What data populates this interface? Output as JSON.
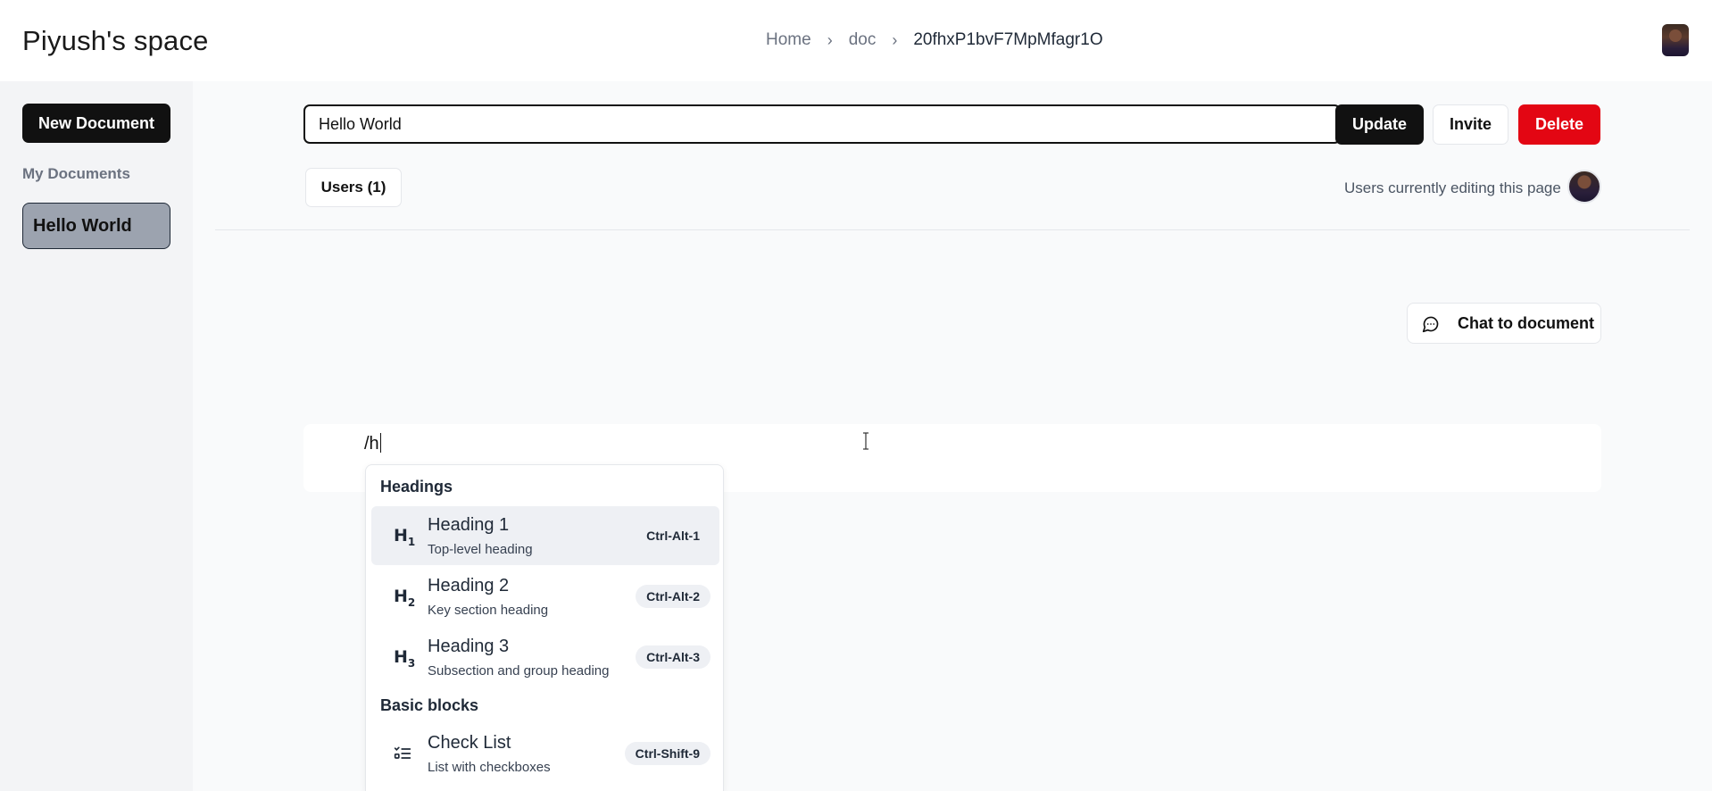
{
  "header": {
    "brand": "Piyush's space",
    "breadcrumb": [
      "Home",
      "doc",
      "20fhxP1bvF7MpMfagr1O"
    ]
  },
  "sidebar": {
    "new_document_label": "New Document",
    "section_label": "My Documents",
    "documents": [
      "Hello World"
    ]
  },
  "toolbar": {
    "title_value": "Hello World",
    "update_label": "Update",
    "invite_label": "Invite",
    "delete_label": "Delete",
    "delete_color": "#e30613"
  },
  "collab": {
    "users_label": "Users (1)",
    "editing_label": "Users currently editing this page"
  },
  "chat": {
    "label": "Chat to document",
    "icon": "chat-bubble-icon"
  },
  "editor": {
    "text": "/h"
  },
  "slash_menu": {
    "groups": [
      {
        "label": "Headings",
        "items": [
          {
            "icon": "H1",
            "title": "Heading 1",
            "subtitle": "Top-level heading",
            "shortcut": "Ctrl-Alt-1",
            "active": true
          },
          {
            "icon": "H2",
            "title": "Heading 2",
            "subtitle": "Key section heading",
            "shortcut": "Ctrl-Alt-2"
          },
          {
            "icon": "H3",
            "title": "Heading 3",
            "subtitle": "Subsection and group heading",
            "shortcut": "Ctrl-Alt-3"
          }
        ]
      },
      {
        "label": "Basic blocks",
        "items": [
          {
            "icon": "check-list-icon",
            "title": "Check List",
            "subtitle": "List with checkboxes",
            "shortcut": "Ctrl-Shift-9"
          }
        ]
      }
    ]
  }
}
